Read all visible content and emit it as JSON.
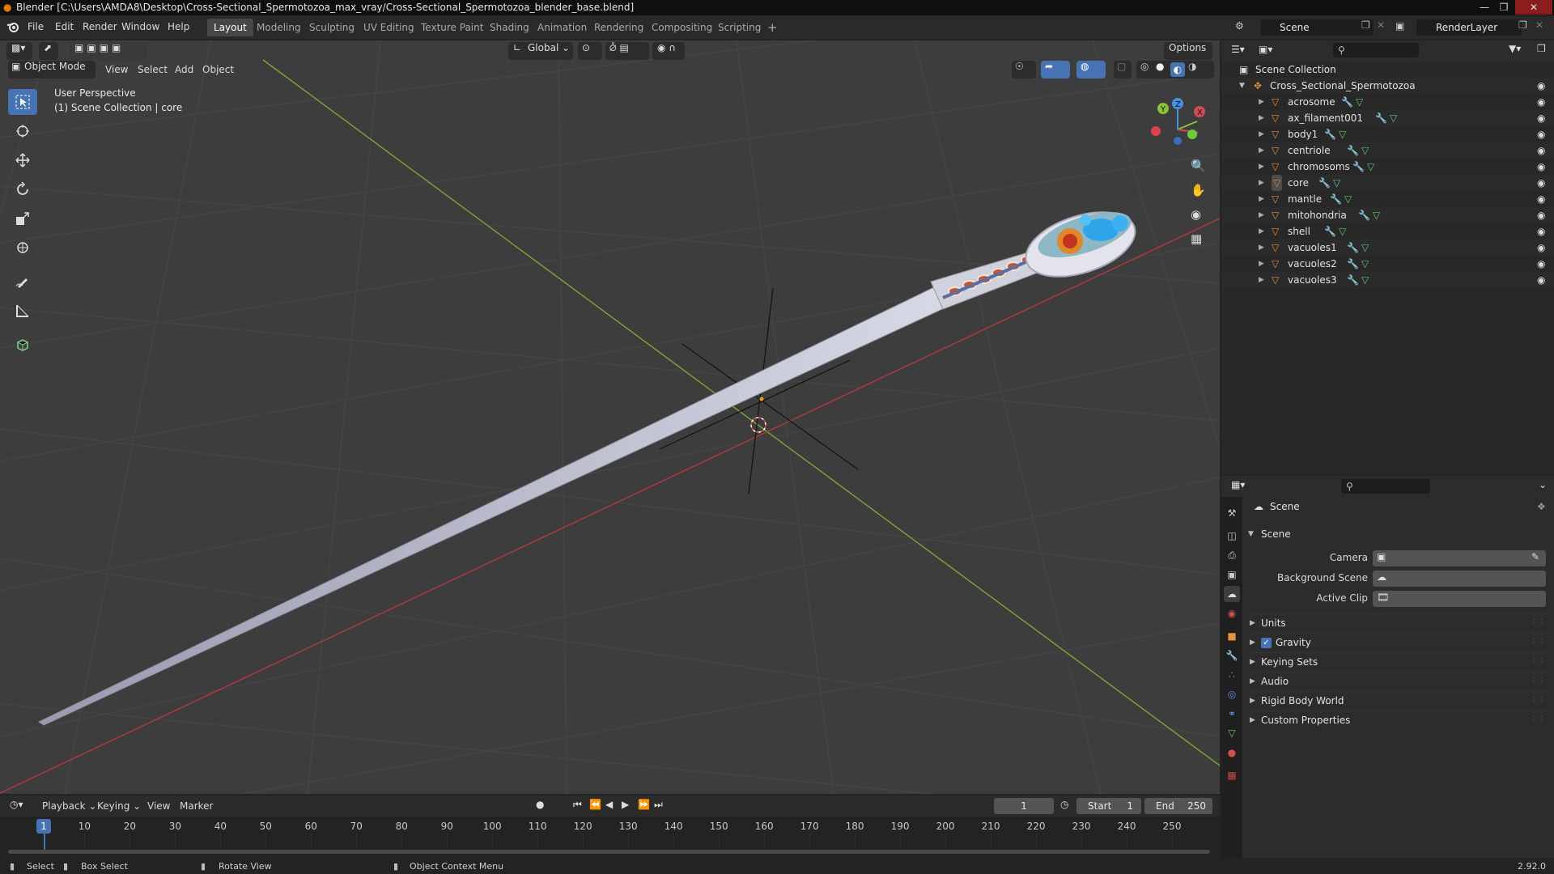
{
  "window": {
    "title": "Blender [C:\\Users\\AMDA8\\Desktop\\Cross-Sectional_Spermotozoa_max_vray/Cross-Sectional_Spermotozoa_blender_base.blend]"
  },
  "menu": [
    "File",
    "Edit",
    "Render",
    "Window",
    "Help"
  ],
  "workspaces": [
    "Layout",
    "Modeling",
    "Sculpting",
    "UV Editing",
    "Texture Paint",
    "Shading",
    "Animation",
    "Rendering",
    "Compositing",
    "Scripting"
  ],
  "active_workspace": "Layout",
  "scene_field": "Scene",
  "renderlayer_field": "RenderLayer",
  "viewport": {
    "mode": "Object Mode",
    "header_menus": [
      "View",
      "Select",
      "Add",
      "Object"
    ],
    "transform_orientation": "Global",
    "options_label": "Options",
    "overlay_line1": "User Perspective",
    "overlay_line2": "(1) Scene Collection | core",
    "gizmo_axes": [
      "X",
      "Y",
      "Z"
    ]
  },
  "outliner": {
    "root": "Scene Collection",
    "collection": "Cross_Sectional_Spermotozoa",
    "objects": [
      "acrosome",
      "ax_filament001",
      "body1",
      "centriole",
      "chromosoms",
      "core",
      "mantle",
      "mitohondria",
      "shell",
      "vacuoles1",
      "vacuoles2",
      "vacuoles3"
    ],
    "active_object": "core"
  },
  "properties": {
    "context": "Scene",
    "panel_title": "Scene",
    "fields": [
      {
        "label": "Camera",
        "value": ""
      },
      {
        "label": "Background Scene",
        "value": ""
      },
      {
        "label": "Active Clip",
        "value": ""
      }
    ],
    "subpanels": [
      "Units",
      "Gravity",
      "Keying Sets",
      "Audio",
      "Rigid Body World",
      "Custom Properties"
    ],
    "gravity_checked": true
  },
  "timeline": {
    "menus": [
      "Playback",
      "Keying",
      "View",
      "Marker"
    ],
    "current_frame": "1",
    "start_label": "Start",
    "start": "1",
    "end_label": "End",
    "end": "250",
    "ticks": [
      "1",
      "10",
      "20",
      "30",
      "40",
      "50",
      "60",
      "70",
      "80",
      "90",
      "100",
      "110",
      "120",
      "130",
      "140",
      "150",
      "160",
      "170",
      "180",
      "190",
      "200",
      "210",
      "220",
      "230",
      "240",
      "250"
    ]
  },
  "statusbar": {
    "select": "Select",
    "box_select": "Box Select",
    "rotate_view": "Rotate View",
    "context_menu": "Object Context Menu",
    "version": "2.92.0"
  },
  "colors": {
    "accent": "#4772b3",
    "x_axis": "#c0393f",
    "y_axis": "#7aa831",
    "viewport_bg": "#3d3d3d",
    "mesh_icon": "#e08a3c"
  }
}
